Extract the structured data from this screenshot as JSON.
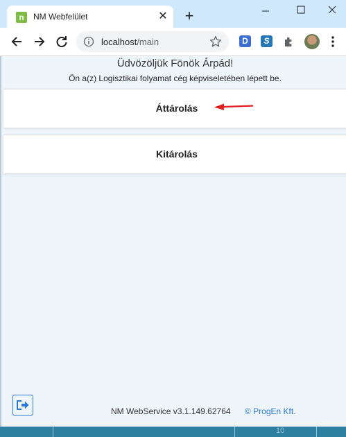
{
  "browser": {
    "tab_title": "NM Webfelület",
    "tab_favicon_letter": "n",
    "new_tab_symbol": "+",
    "close_symbol": "✕",
    "url_host": "localhost",
    "url_path": "/main",
    "extensions": [
      {
        "name": "extension-d",
        "letter": "D",
        "color": "#3b6fd6"
      },
      {
        "name": "extension-s",
        "letter": "S",
        "color": "#2677b8"
      }
    ]
  },
  "page": {
    "welcome": "Üdvözöljük Fönök Árpád!",
    "subtitle": "Ön a(z) Logisztikai folyamat cég képviseletében lépett be.",
    "menu": [
      {
        "label": "Áttárolás"
      },
      {
        "label": "Kitárolás"
      }
    ],
    "footer": {
      "version": "NM WebService v3.1.149.62764",
      "link": "© ProgEn Kft."
    }
  },
  "desktop_strip": {
    "text_left": "",
    "text_right": "10"
  },
  "colors": {
    "page_bg": "#eef5fb",
    "accent": "#2a7ad6",
    "annotation_arrow": "#e02020",
    "tabstrip": "#cfe8fc"
  }
}
